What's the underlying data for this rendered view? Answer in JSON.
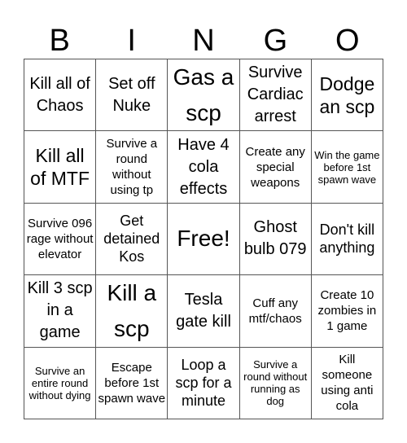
{
  "header": {
    "letters": [
      "B",
      "I",
      "N",
      "G",
      "O"
    ]
  },
  "cells": [
    [
      "Kill all of Chaos",
      "Set off Nuke",
      "Gas a scp",
      "Survive Cardiac arrest",
      "Dodge an scp"
    ],
    [
      "Kill all of MTF",
      "Survive a round without using tp",
      "Have 4 cola effects",
      "Create any special weapons",
      "Win the game before 1st spawn wave"
    ],
    [
      "Survive 096 rage without elevator",
      "Get detained Kos",
      "Free!",
      "Ghost bulb 079",
      "Don't kill anything"
    ],
    [
      "Kill 3 scp in a game",
      "Kill a scp",
      "Tesla gate kill",
      "Cuff any mtf/chaos",
      "Create 10 zombies in 1 game"
    ],
    [
      "Survive an entire round without dying",
      "Escape before 1st spawn wave",
      "Loop a scp for a minute",
      "Survive a round without running as dog",
      "Kill someone using anti cola"
    ]
  ]
}
